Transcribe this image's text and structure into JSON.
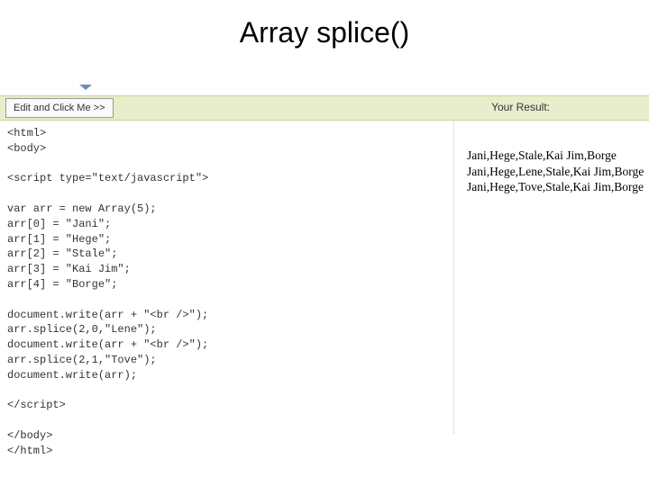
{
  "title": "Array splice()",
  "editButton": "Edit and Click Me >>",
  "resultLabel": "Your Result:",
  "code": "<html>\n<body>\n\n<script type=\"text/javascript\">\n\nvar arr = new Array(5);\narr[0] = \"Jani\";\narr[1] = \"Hege\";\narr[2] = \"Stale\";\narr[3] = \"Kai Jim\";\narr[4] = \"Borge\";\n\ndocument.write(arr + \"<br />\");\narr.splice(2,0,\"Lene\");\ndocument.write(arr + \"<br />\");\narr.splice(2,1,\"Tove\");\ndocument.write(arr);\n\n</script>\n\n</body>\n</html>",
  "result": {
    "line1": "Jani,Hege,Stale,Kai Jim,Borge",
    "line2": "Jani,Hege,Lene,Stale,Kai Jim,Borge",
    "line3": "Jani,Hege,Tove,Stale,Kai Jim,Borge"
  }
}
